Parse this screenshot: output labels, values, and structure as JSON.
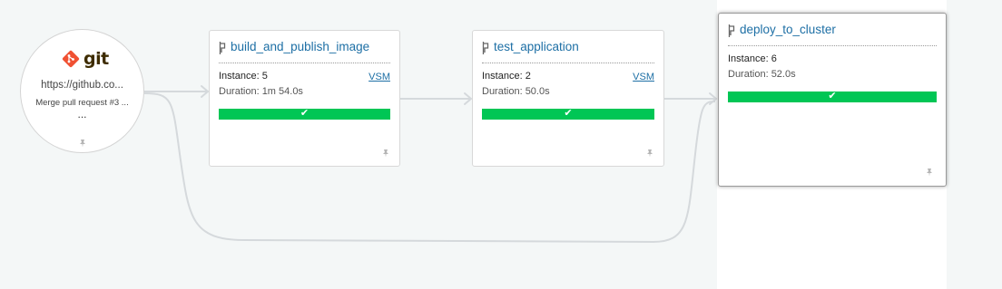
{
  "material": {
    "logo_text": "git",
    "url": "https://github.co...",
    "commit": "Merge pull request #3 ...",
    "more": "..."
  },
  "stages": [
    {
      "name": "build_and_publish_image",
      "instance_label": "Instance: 5",
      "duration_label": "Duration: 1m 54.0s",
      "vsm_label": "VSM",
      "status": "passed"
    },
    {
      "name": "test_application",
      "instance_label": "Instance: 2",
      "duration_label": "Duration: 50.0s",
      "vsm_label": "VSM",
      "status": "passed"
    },
    {
      "name": "deploy_to_cluster",
      "instance_label": "Instance: 6",
      "duration_label": "Duration: 52.0s",
      "status": "passed",
      "selected": true
    }
  ],
  "colors": {
    "passed": "#00c655",
    "link": "#1d6fa5",
    "git_brand": "#f05133",
    "connector": "#d5d9dc"
  },
  "icons": {
    "pin": "pin-icon",
    "stage": "pipeline-stage-icon",
    "status": "check-icon",
    "git": "git-logo-icon"
  }
}
